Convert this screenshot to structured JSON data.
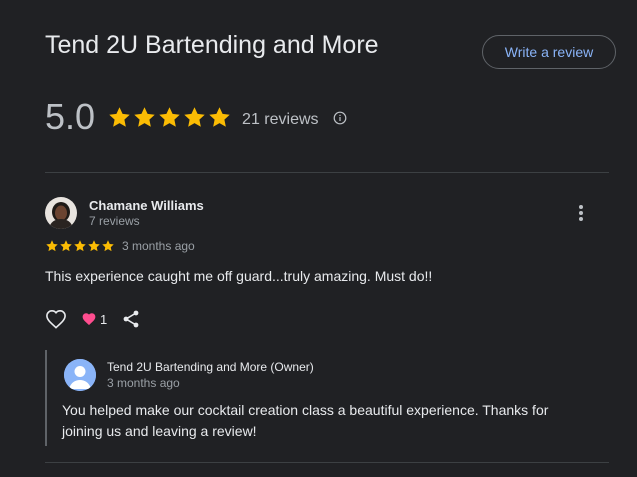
{
  "business": {
    "title": "Tend 2U Bartending and More",
    "write_review_label": "Write a review"
  },
  "summary": {
    "rating": "5.0",
    "stars": 5,
    "review_count": "21 reviews"
  },
  "review": {
    "author": "Chamane Williams",
    "author_reviews": "7 reviews",
    "stars": 5,
    "date": "3 months ago",
    "text": "This experience caught me off guard...truly amazing. Must do!!",
    "reaction_count": "1"
  },
  "owner_reply": {
    "name": "Tend 2U Bartending and More (Owner)",
    "date": "3 months ago",
    "text": "You helped make our cocktail creation class a beautiful experience. Thanks for joining us and leaving a review!"
  },
  "colors": {
    "background": "#202124",
    "star": "#fbbc04",
    "link": "#8ab4f8",
    "heart_fill": "#ff4d8f"
  },
  "icons": [
    "star-icon",
    "info-icon",
    "more-vert-icon",
    "heart-outline-icon",
    "heart-filled-icon",
    "share-icon"
  ]
}
